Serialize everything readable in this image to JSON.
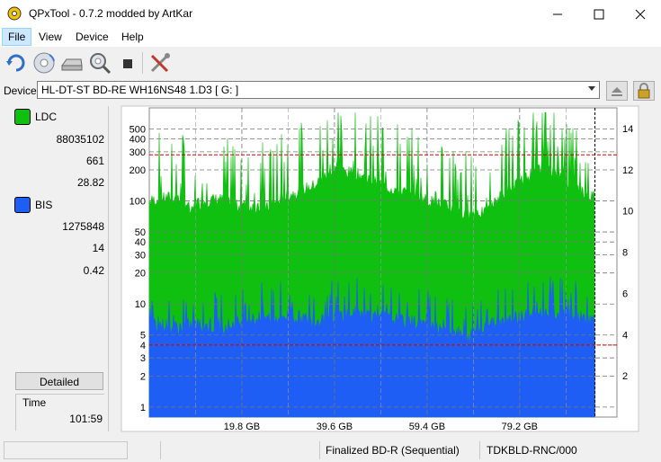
{
  "window": {
    "title": "QPxTool - 0.7.2 modded by ArtKar"
  },
  "menu": [
    "File",
    "View",
    "Device",
    "Help"
  ],
  "toolbar": {
    "icons": [
      "refresh-icon",
      "disc-icon",
      "drive-icon",
      "magnifier-disc-icon",
      "stop-icon",
      "tools-icon"
    ]
  },
  "device": {
    "label": "Device:",
    "value": "HL-DT-ST BD-RE  WH16NS48  1.D3 [ G: ]"
  },
  "stats": {
    "ldc": {
      "label": "LDC",
      "color": "#10c010",
      "total": "88035102",
      "max": "661",
      "avg": "28.82"
    },
    "bis": {
      "label": "BIS",
      "color": "#1e5ef5",
      "total": "1275848",
      "max": "14",
      "avg": "0.42"
    }
  },
  "detailed_label": "Detailed",
  "time": {
    "label": "Time",
    "value": "101:59"
  },
  "status": {
    "disc": "Finalized BD-R (Sequential)",
    "media_id": "TDKBLD-RNC/000"
  },
  "chart_data": {
    "type": "area",
    "x_axis": {
      "unit": "GB",
      "range": [
        0,
        100
      ],
      "tick_labels": [
        "19.8 GB",
        "39.6 GB",
        "59.4 GB",
        "79.2 GB"
      ],
      "ticks": [
        19.8,
        39.6,
        59.4,
        79.2
      ]
    },
    "y_left": {
      "scale": "log",
      "range": [
        0.8,
        800
      ],
      "tick_labels": [
        "1",
        "2",
        "3",
        "4",
        "5",
        "10",
        "20",
        "30",
        "40",
        "50",
        "100",
        "200",
        "300",
        "400",
        "500"
      ]
    },
    "y_right": {
      "range": [
        0,
        15
      ],
      "tick_labels": [
        "2",
        "4",
        "6",
        "8",
        "10",
        "12",
        "14"
      ]
    },
    "thresholds": {
      "ldc_red_line": 280,
      "bis_red_line": 4
    },
    "end_marker_gb": 95.3,
    "series": [
      {
        "name": "LDC",
        "color": "#10c010",
        "x": [
          0,
          5,
          8,
          9,
          10,
          12,
          15,
          18,
          20,
          25,
          30,
          35,
          40,
          45,
          50,
          55,
          60,
          65,
          68,
          70,
          72,
          75,
          80,
          85,
          90,
          95
        ],
        "y": [
          100,
          110,
          95,
          75,
          95,
          100,
          105,
          90,
          90,
          85,
          115,
          140,
          200,
          180,
          140,
          120,
          100,
          85,
          70,
          80,
          75,
          110,
          160,
          220,
          140,
          110
        ]
      },
      {
        "name": "BIS",
        "color": "#1e5ef5",
        "x": [
          0,
          5,
          10,
          15,
          20,
          25,
          30,
          35,
          40,
          45,
          50,
          55,
          60,
          65,
          68,
          70,
          75,
          80,
          85,
          90,
          95
        ],
        "y": [
          7,
          6,
          6.5,
          6,
          7,
          7.5,
          8,
          7,
          8,
          8.5,
          7.5,
          7,
          6.5,
          6,
          4.5,
          6,
          7,
          8,
          8.5,
          8,
          7
        ]
      }
    ]
  }
}
